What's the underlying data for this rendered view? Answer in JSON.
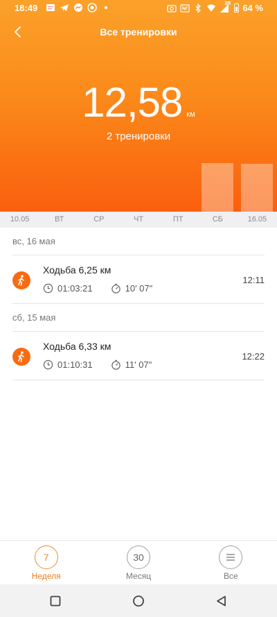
{
  "status_bar": {
    "time": "18:49",
    "battery_percent": "64 %",
    "network_label": "2R",
    "left_icons": [
      "message-icon",
      "telegram-icon",
      "messenger-icon",
      "app-icon",
      "dot-icon"
    ],
    "right_icons": [
      "camera-icon",
      "nfc-icon",
      "bluetooth-icon",
      "wifi-icon",
      "signal-icon",
      "battery-icon"
    ]
  },
  "header": {
    "title": "Все тренировки",
    "back_icon": "back-chevron-icon"
  },
  "summary": {
    "total_value": "12,58",
    "total_unit": "км",
    "workouts_count": "2 тренировки"
  },
  "chart_data": {
    "type": "bar",
    "categories": [
      "10.05",
      "ВТ",
      "СР",
      "ЧТ",
      "ПТ",
      "СБ",
      "16.05"
    ],
    "values": [
      0,
      0,
      0,
      0,
      0,
      6.33,
      6.25
    ],
    "ylim": [
      0,
      6.6
    ],
    "bar_color": "#ffffff"
  },
  "sections": [
    {
      "date": "вс, 16 мая",
      "workouts": [
        {
          "title": "Ходьба 6,25 км",
          "duration": "01:03:21",
          "pace": "10' 07\"",
          "time": "12:11",
          "icon": "walking-icon"
        }
      ]
    },
    {
      "date": "сб, 15 мая",
      "workouts": [
        {
          "title": "Ходьба 6,33 км",
          "duration": "01:10:31",
          "pace": "11' 07\"",
          "time": "12:22",
          "icon": "walking-icon"
        }
      ]
    }
  ],
  "tabs": [
    {
      "number": "7",
      "label": "Неделя",
      "active": true
    },
    {
      "number": "30",
      "label": "Месяц",
      "active": false
    },
    {
      "number": "",
      "label": "Все",
      "active": false,
      "icon": "menu-lines-icon"
    }
  ],
  "colors": {
    "accent": "#fa6a12",
    "hero_top": "#fba12a",
    "hero_bottom": "#fa5f0e",
    "active_tab": "#f08a30"
  },
  "nav_bar": {
    "buttons": [
      "recent-apps-icon",
      "home-icon",
      "back-triangle-icon"
    ]
  }
}
